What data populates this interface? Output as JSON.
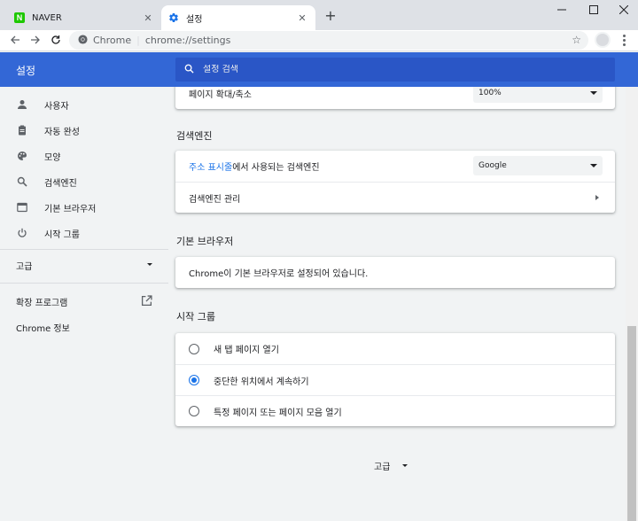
{
  "browser": {
    "tabs": [
      {
        "title": "NAVER",
        "icon": "naver-icon"
      },
      {
        "title": "설정",
        "icon": "gear-icon"
      }
    ],
    "address": {
      "chip": "Chrome",
      "url": "chrome://settings"
    }
  },
  "settings": {
    "title": "설정",
    "search_placeholder": "설정 검색",
    "nav": [
      {
        "label": "사용자",
        "icon": "person-icon"
      },
      {
        "label": "자동 완성",
        "icon": "clipboard-icon"
      },
      {
        "label": "모양",
        "icon": "palette-icon"
      },
      {
        "label": "검색엔진",
        "icon": "search-icon"
      },
      {
        "label": "기본 브라우저",
        "icon": "browser-icon"
      },
      {
        "label": "시작 그룹",
        "icon": "power-icon"
      }
    ],
    "advanced_label": "고급",
    "extensions_label": "확장 프로그램",
    "about_label": "Chrome 정보"
  },
  "main": {
    "zoom": {
      "label": "페이지 확대/축소",
      "value": "100%"
    },
    "search_engine": {
      "title": "검색엔진",
      "address_bar_link": "주소 표시줄",
      "address_bar_rest": "에서 사용되는 검색엔진",
      "engine_value": "Google",
      "manage_label": "검색엔진 관리"
    },
    "default_browser": {
      "title": "기본 브라우저",
      "status": "Chrome이 기본 브라우저로 설정되어 있습니다."
    },
    "startup": {
      "title": "시작 그룹",
      "options": [
        {
          "label": "새 탭 페이지 열기",
          "checked": false
        },
        {
          "label": "중단한 위치에서 계속하기",
          "checked": true
        },
        {
          "label": "특정 페이지 또는 페이지 모음 열기",
          "checked": false
        }
      ]
    },
    "advanced_label": "고급"
  },
  "colors": {
    "header": "#3367d6",
    "accent": "#1a73e8"
  }
}
